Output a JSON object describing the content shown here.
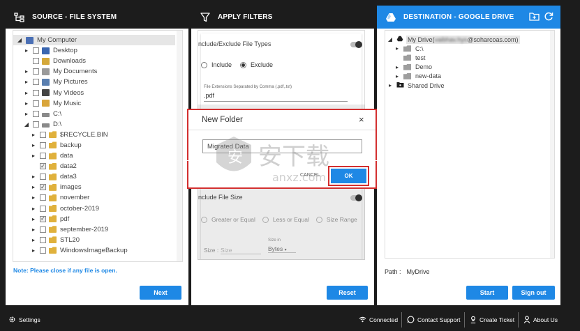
{
  "source": {
    "title": "SOURCE - FILE SYSTEM",
    "tree": [
      {
        "label": "My Computer",
        "level": 0,
        "arrow": "down",
        "check": "none",
        "icon": "computer"
      },
      {
        "label": "Desktop",
        "level": 1,
        "arrow": "right",
        "check": "empty",
        "icon": "desktop"
      },
      {
        "label": "Downloads",
        "level": 1,
        "arrow": "",
        "check": "empty",
        "icon": "download"
      },
      {
        "label": "My Documents",
        "level": 1,
        "arrow": "right",
        "check": "empty",
        "icon": "document"
      },
      {
        "label": "My Pictures",
        "level": 1,
        "arrow": "right",
        "check": "empty",
        "icon": "picture"
      },
      {
        "label": "My Videos",
        "level": 1,
        "arrow": "right",
        "check": "empty",
        "icon": "video"
      },
      {
        "label": "My Music",
        "level": 1,
        "arrow": "right",
        "check": "empty",
        "icon": "music"
      },
      {
        "label": "C:\\",
        "level": 1,
        "arrow": "right",
        "check": "empty",
        "icon": "drive"
      },
      {
        "label": "D:\\",
        "level": 1,
        "arrow": "down",
        "check": "empty",
        "icon": "drive"
      },
      {
        "label": "$RECYCLE.BIN",
        "level": 2,
        "arrow": "right",
        "check": "empty",
        "icon": "folder"
      },
      {
        "label": "backup",
        "level": 2,
        "arrow": "right",
        "check": "empty",
        "icon": "folder"
      },
      {
        "label": "data",
        "level": 2,
        "arrow": "right",
        "check": "empty",
        "icon": "folder"
      },
      {
        "label": "data2",
        "level": 2,
        "arrow": "",
        "check": "checked",
        "icon": "folder"
      },
      {
        "label": "data3",
        "level": 2,
        "arrow": "right",
        "check": "empty",
        "icon": "folder"
      },
      {
        "label": "images",
        "level": 2,
        "arrow": "right",
        "check": "checked",
        "icon": "folder"
      },
      {
        "label": "november",
        "level": 2,
        "arrow": "right",
        "check": "empty",
        "icon": "folder"
      },
      {
        "label": "october-2019",
        "level": 2,
        "arrow": "right",
        "check": "empty",
        "icon": "folder"
      },
      {
        "label": "pdf",
        "level": 2,
        "arrow": "right",
        "check": "checked",
        "icon": "folder"
      },
      {
        "label": "september-2019",
        "level": 2,
        "arrow": "right",
        "check": "empty",
        "icon": "folder"
      },
      {
        "label": "STL20",
        "level": 2,
        "arrow": "right",
        "check": "empty",
        "icon": "folder"
      },
      {
        "label": "WindowsImageBackup",
        "level": 2,
        "arrow": "right",
        "check": "empty",
        "icon": "folder"
      }
    ],
    "note": "Note: Please close if any file is open.",
    "next_label": "Next"
  },
  "filters": {
    "title": "APPLY FILTERS",
    "file_types_title": "nclude/Exclude File Types",
    "include_label": "Include",
    "exclude_label": "Exclude",
    "selected": "Exclude",
    "ext_caption": "File Extensions Separated by Comma (.pdf,.txt)",
    "ext_value": ".pdf",
    "file_size_title": "nclude File Size",
    "greater_label": "Greater or Equal",
    "less_label": "Less or Equal",
    "range_label": "Size Range",
    "size_label": "Size :",
    "size_placeholder": "Size",
    "size_in_caption": "Size in",
    "size_unit": "Bytes",
    "reset_label": "Reset"
  },
  "modal": {
    "title": "New Folder",
    "input_value": "Migrated Data",
    "cancel_label": "CANCEL",
    "ok_label": "OK"
  },
  "destination": {
    "title": "DESTINATION - GOOGLE DRIVE",
    "root_prefix": "My Drive(",
    "root_email_blur": "vaibhav.hys",
    "root_suffix": "@soharcoas.com)",
    "items": [
      {
        "label": "C:\\",
        "arrow": "right"
      },
      {
        "label": "test",
        "arrow": ""
      },
      {
        "label": "Demo",
        "arrow": "right"
      },
      {
        "label": "new-data",
        "arrow": "right"
      }
    ],
    "shared_label": "Shared Drive",
    "path_label": "Path :",
    "path_value": "MyDrive",
    "start_label": "Start",
    "signout_label": "Sign out"
  },
  "statusbar": {
    "settings": "Settings",
    "connected": "Connected",
    "contact": "Contact Support",
    "ticket": "Create Ticket",
    "about": "About Us"
  },
  "colors": {
    "accent": "#1e88e5",
    "dark": "#1c1c1c",
    "highlight_red": "#d32f2f"
  }
}
